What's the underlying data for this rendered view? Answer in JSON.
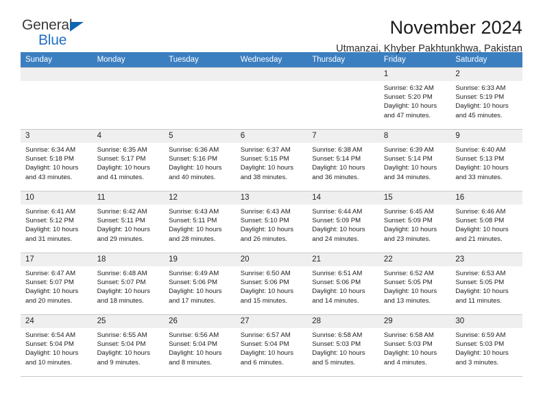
{
  "brand": {
    "name_top": "General",
    "name_bottom": "Blue",
    "triangle_icon": "brand-triangle-icon",
    "accent_color": "#1066b0"
  },
  "header": {
    "month_title": "November 2024",
    "location": "Utmanzai, Khyber Pakhtunkhwa, Pakistan",
    "header_bg_color": "#3c7fc1",
    "daynum_bg_color": "#efefef"
  },
  "weekday_headers": [
    "Sunday",
    "Monday",
    "Tuesday",
    "Wednesday",
    "Thursday",
    "Friday",
    "Saturday"
  ],
  "weeks": [
    {
      "days": [
        {
          "num": "",
          "empty": true,
          "sunrise": "",
          "sunset": "",
          "daylight": ""
        },
        {
          "num": "",
          "empty": true,
          "sunrise": "",
          "sunset": "",
          "daylight": ""
        },
        {
          "num": "",
          "empty": true,
          "sunrise": "",
          "sunset": "",
          "daylight": ""
        },
        {
          "num": "",
          "empty": true,
          "sunrise": "",
          "sunset": "",
          "daylight": ""
        },
        {
          "num": "",
          "empty": true,
          "sunrise": "",
          "sunset": "",
          "daylight": ""
        },
        {
          "num": "1",
          "empty": false,
          "sunrise": "Sunrise: 6:32 AM",
          "sunset": "Sunset: 5:20 PM",
          "daylight": "Daylight: 10 hours and 47 minutes."
        },
        {
          "num": "2",
          "empty": false,
          "sunrise": "Sunrise: 6:33 AM",
          "sunset": "Sunset: 5:19 PM",
          "daylight": "Daylight: 10 hours and 45 minutes."
        }
      ]
    },
    {
      "days": [
        {
          "num": "3",
          "empty": false,
          "sunrise": "Sunrise: 6:34 AM",
          "sunset": "Sunset: 5:18 PM",
          "daylight": "Daylight: 10 hours and 43 minutes."
        },
        {
          "num": "4",
          "empty": false,
          "sunrise": "Sunrise: 6:35 AM",
          "sunset": "Sunset: 5:17 PM",
          "daylight": "Daylight: 10 hours and 41 minutes."
        },
        {
          "num": "5",
          "empty": false,
          "sunrise": "Sunrise: 6:36 AM",
          "sunset": "Sunset: 5:16 PM",
          "daylight": "Daylight: 10 hours and 40 minutes."
        },
        {
          "num": "6",
          "empty": false,
          "sunrise": "Sunrise: 6:37 AM",
          "sunset": "Sunset: 5:15 PM",
          "daylight": "Daylight: 10 hours and 38 minutes."
        },
        {
          "num": "7",
          "empty": false,
          "sunrise": "Sunrise: 6:38 AM",
          "sunset": "Sunset: 5:14 PM",
          "daylight": "Daylight: 10 hours and 36 minutes."
        },
        {
          "num": "8",
          "empty": false,
          "sunrise": "Sunrise: 6:39 AM",
          "sunset": "Sunset: 5:14 PM",
          "daylight": "Daylight: 10 hours and 34 minutes."
        },
        {
          "num": "9",
          "empty": false,
          "sunrise": "Sunrise: 6:40 AM",
          "sunset": "Sunset: 5:13 PM",
          "daylight": "Daylight: 10 hours and 33 minutes."
        }
      ]
    },
    {
      "days": [
        {
          "num": "10",
          "empty": false,
          "sunrise": "Sunrise: 6:41 AM",
          "sunset": "Sunset: 5:12 PM",
          "daylight": "Daylight: 10 hours and 31 minutes."
        },
        {
          "num": "11",
          "empty": false,
          "sunrise": "Sunrise: 6:42 AM",
          "sunset": "Sunset: 5:11 PM",
          "daylight": "Daylight: 10 hours and 29 minutes."
        },
        {
          "num": "12",
          "empty": false,
          "sunrise": "Sunrise: 6:43 AM",
          "sunset": "Sunset: 5:11 PM",
          "daylight": "Daylight: 10 hours and 28 minutes."
        },
        {
          "num": "13",
          "empty": false,
          "sunrise": "Sunrise: 6:43 AM",
          "sunset": "Sunset: 5:10 PM",
          "daylight": "Daylight: 10 hours and 26 minutes."
        },
        {
          "num": "14",
          "empty": false,
          "sunrise": "Sunrise: 6:44 AM",
          "sunset": "Sunset: 5:09 PM",
          "daylight": "Daylight: 10 hours and 24 minutes."
        },
        {
          "num": "15",
          "empty": false,
          "sunrise": "Sunrise: 6:45 AM",
          "sunset": "Sunset: 5:09 PM",
          "daylight": "Daylight: 10 hours and 23 minutes."
        },
        {
          "num": "16",
          "empty": false,
          "sunrise": "Sunrise: 6:46 AM",
          "sunset": "Sunset: 5:08 PM",
          "daylight": "Daylight: 10 hours and 21 minutes."
        }
      ]
    },
    {
      "days": [
        {
          "num": "17",
          "empty": false,
          "sunrise": "Sunrise: 6:47 AM",
          "sunset": "Sunset: 5:07 PM",
          "daylight": "Daylight: 10 hours and 20 minutes."
        },
        {
          "num": "18",
          "empty": false,
          "sunrise": "Sunrise: 6:48 AM",
          "sunset": "Sunset: 5:07 PM",
          "daylight": "Daylight: 10 hours and 18 minutes."
        },
        {
          "num": "19",
          "empty": false,
          "sunrise": "Sunrise: 6:49 AM",
          "sunset": "Sunset: 5:06 PM",
          "daylight": "Daylight: 10 hours and 17 minutes."
        },
        {
          "num": "20",
          "empty": false,
          "sunrise": "Sunrise: 6:50 AM",
          "sunset": "Sunset: 5:06 PM",
          "daylight": "Daylight: 10 hours and 15 minutes."
        },
        {
          "num": "21",
          "empty": false,
          "sunrise": "Sunrise: 6:51 AM",
          "sunset": "Sunset: 5:06 PM",
          "daylight": "Daylight: 10 hours and 14 minutes."
        },
        {
          "num": "22",
          "empty": false,
          "sunrise": "Sunrise: 6:52 AM",
          "sunset": "Sunset: 5:05 PM",
          "daylight": "Daylight: 10 hours and 13 minutes."
        },
        {
          "num": "23",
          "empty": false,
          "sunrise": "Sunrise: 6:53 AM",
          "sunset": "Sunset: 5:05 PM",
          "daylight": "Daylight: 10 hours and 11 minutes."
        }
      ]
    },
    {
      "days": [
        {
          "num": "24",
          "empty": false,
          "sunrise": "Sunrise: 6:54 AM",
          "sunset": "Sunset: 5:04 PM",
          "daylight": "Daylight: 10 hours and 10 minutes."
        },
        {
          "num": "25",
          "empty": false,
          "sunrise": "Sunrise: 6:55 AM",
          "sunset": "Sunset: 5:04 PM",
          "daylight": "Daylight: 10 hours and 9 minutes."
        },
        {
          "num": "26",
          "empty": false,
          "sunrise": "Sunrise: 6:56 AM",
          "sunset": "Sunset: 5:04 PM",
          "daylight": "Daylight: 10 hours and 8 minutes."
        },
        {
          "num": "27",
          "empty": false,
          "sunrise": "Sunrise: 6:57 AM",
          "sunset": "Sunset: 5:04 PM",
          "daylight": "Daylight: 10 hours and 6 minutes."
        },
        {
          "num": "28",
          "empty": false,
          "sunrise": "Sunrise: 6:58 AM",
          "sunset": "Sunset: 5:03 PM",
          "daylight": "Daylight: 10 hours and 5 minutes."
        },
        {
          "num": "29",
          "empty": false,
          "sunrise": "Sunrise: 6:58 AM",
          "sunset": "Sunset: 5:03 PM",
          "daylight": "Daylight: 10 hours and 4 minutes."
        },
        {
          "num": "30",
          "empty": false,
          "sunrise": "Sunrise: 6:59 AM",
          "sunset": "Sunset: 5:03 PM",
          "daylight": "Daylight: 10 hours and 3 minutes."
        }
      ]
    }
  ]
}
